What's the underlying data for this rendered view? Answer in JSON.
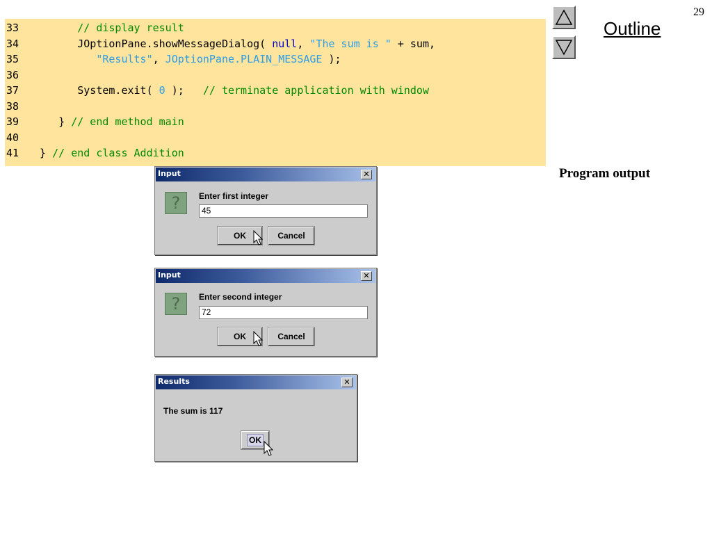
{
  "slide": {
    "number": "29",
    "outline_label": "Outline",
    "program_output_label": "Program output"
  },
  "code": {
    "lines": [
      {
        "n": "33",
        "parts": [
          {
            "t": "pl",
            "s": "        "
          },
          {
            "t": "cm",
            "s": "// display result"
          }
        ]
      },
      {
        "n": "34",
        "parts": [
          {
            "t": "pl",
            "s": "        JOptionPane.showMessageDialog( "
          },
          {
            "t": "kw",
            "s": "null"
          },
          {
            "t": "pl",
            "s": ", "
          },
          {
            "t": "str",
            "s": "\"The sum is \""
          },
          {
            "t": "pl",
            "s": " + sum,"
          }
        ]
      },
      {
        "n": "35",
        "parts": [
          {
            "t": "pl",
            "s": "           "
          },
          {
            "t": "str",
            "s": "\"Results\""
          },
          {
            "t": "pl",
            "s": ", "
          },
          {
            "t": "str",
            "s": "JOptionPane.PLAIN_MESSAGE"
          },
          {
            "t": "pl",
            "s": " );"
          }
        ]
      },
      {
        "n": "36",
        "parts": []
      },
      {
        "n": "37",
        "parts": [
          {
            "t": "pl",
            "s": "        System.exit( "
          },
          {
            "t": "num",
            "s": "0"
          },
          {
            "t": "pl",
            "s": " );   "
          },
          {
            "t": "cm",
            "s": "// terminate application with window"
          }
        ]
      },
      {
        "n": "38",
        "parts": []
      },
      {
        "n": "39",
        "parts": [
          {
            "t": "pl",
            "s": "     } "
          },
          {
            "t": "cm",
            "s": "// end method main"
          }
        ]
      },
      {
        "n": "40",
        "parts": []
      },
      {
        "n": "41",
        "parts": [
          {
            "t": "pl",
            "s": "  } "
          },
          {
            "t": "cm",
            "s": "// end class Addition"
          }
        ]
      }
    ]
  },
  "dialogs": {
    "input1": {
      "title": "Input",
      "close_glyph": "✕",
      "icon": "question-icon",
      "prompt": "Enter first integer",
      "value": "45",
      "ok_label": "OK",
      "cancel_label": "Cancel"
    },
    "input2": {
      "title": "Input",
      "close_glyph": "✕",
      "icon": "question-icon",
      "prompt": "Enter second integer",
      "value": "72",
      "ok_label": "OK",
      "cancel_label": "Cancel"
    },
    "results": {
      "title": "Results",
      "close_glyph": "✕",
      "message": "The sum is 117",
      "ok_label": "OK"
    }
  },
  "colors": {
    "code_background": "#ffe49e",
    "comment": "#008800",
    "keyword": "#0000cc",
    "string": "#2c9ce6",
    "dialog_background": "#cccccc",
    "titlebar_dark": "#0f2a6b",
    "titlebar_light": "#a9c2ea"
  }
}
